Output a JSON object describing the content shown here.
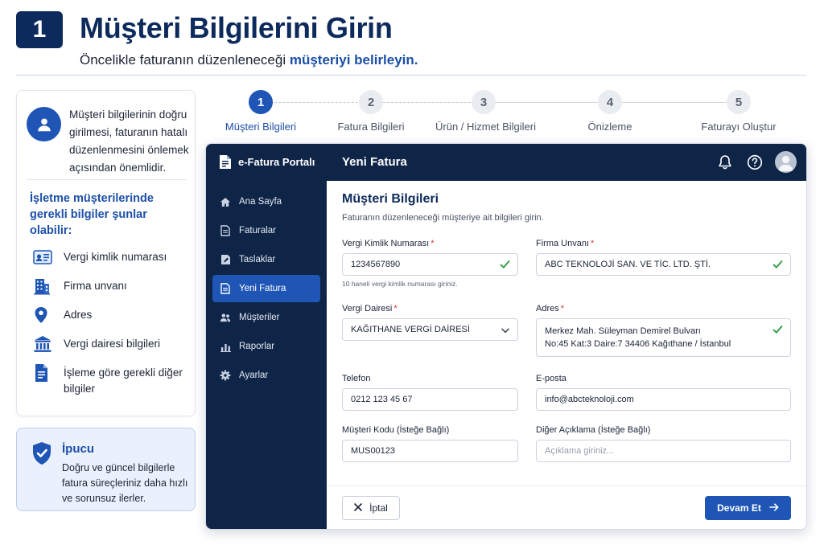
{
  "header": {
    "step_number": "1",
    "title": "Müşteri Bilgilerini Girin",
    "subtitle_plain": "Öncelikle faturanın düzenleneceği ",
    "subtitle_bold": "müşteriyi belirleyin."
  },
  "info": {
    "intro": "Müşteri bilgilerinin doğru girilmesi, faturanın hatalı düzenlenmesini önlemek açısından önemlidir.",
    "requirements_title": "İşletme müşterilerinde gerekli bilgiler şunlar olabilir:",
    "requirements": [
      {
        "icon": "id-card-icon",
        "label": "Vergi kimlik numarası"
      },
      {
        "icon": "building-icon",
        "label": "Firma unvanı"
      },
      {
        "icon": "location-pin-icon",
        "label": "Adres"
      },
      {
        "icon": "bank-icon",
        "label": "Vergi dairesi bilgileri"
      },
      {
        "icon": "document-icon",
        "label": "İşleme göre gerekli diğer bilgiler"
      }
    ]
  },
  "tip": {
    "title": "İpucu",
    "text": "Doğru ve güncel bilgilerle fatura süreçleriniz daha hızlı ve sorunsuz ilerler."
  },
  "stepper": {
    "current_step": 1,
    "steps": [
      {
        "number": "1",
        "label": "Müşteri Bilgileri"
      },
      {
        "number": "2",
        "label": "Fatura Bilgileri"
      },
      {
        "number": "3",
        "label": "Ürün / Hizmet Bilgileri"
      },
      {
        "number": "4",
        "label": "Önizleme"
      },
      {
        "number": "5",
        "label": "Faturayı Oluştur"
      }
    ]
  },
  "app": {
    "logo_text": "e-Fatura Portalı",
    "topbar_title": "Yeni Fatura",
    "nav": [
      {
        "icon": "home-icon",
        "label": "Ana Sayfa",
        "active": false
      },
      {
        "icon": "invoice-icon",
        "label": "Faturalar",
        "active": false
      },
      {
        "icon": "draft-icon",
        "label": "Taslaklar",
        "active": false
      },
      {
        "icon": "new-invoice-icon",
        "label": "Yeni Fatura",
        "active": true
      },
      {
        "icon": "customers-icon",
        "label": "Müşteriler",
        "active": false
      },
      {
        "icon": "reports-icon",
        "label": "Raporlar",
        "active": false
      },
      {
        "icon": "settings-icon",
        "label": "Ayarlar",
        "active": false
      }
    ],
    "form": {
      "title": "Müşteri Bilgileri",
      "subtitle": "Faturanın düzenleneceği müşteriye ait bilgileri girin.",
      "required_mark": "*",
      "tax_id": {
        "label": "Vergi Kimlik Numarası",
        "value": "1234567890",
        "help": "10 haneli vergi kimlik numarası giriniz.",
        "valid": true
      },
      "company": {
        "label": "Firma Unvanı",
        "value": "ABC TEKNOLOJİ SAN. VE TİC. LTD. ŞTİ.",
        "valid": true
      },
      "tax_office": {
        "label": "Vergi Dairesi",
        "value": "KAĞITHANE VERGİ DAİRESİ"
      },
      "address": {
        "label": "Adres",
        "line1": "Merkez Mah. Süleyman Demirel Bulvarı",
        "line2": "No:45 Kat:3 Daire:7 34406 Kağıthane / İstanbul",
        "valid": true
      },
      "phone": {
        "label": "Telefon",
        "value": "0212 123 45 67"
      },
      "email": {
        "label": "E-posta",
        "value": "info@abcteknoloji.com"
      },
      "customer_code": {
        "label": "Müşteri Kodu (İsteğe Bağlı)",
        "value": "MUS00123"
      },
      "note": {
        "label": "Diğer Açıklama (İsteğe Bağlı)",
        "placeholder": "Açıklama giriniz..."
      }
    },
    "footer": {
      "cancel_label": "İptal",
      "next_label": "Devam Et"
    }
  },
  "colors": {
    "navy": "#0f2547",
    "primary": "#1f56b5",
    "valid_check": "#2e9e4a",
    "required": "#d23a3a"
  }
}
